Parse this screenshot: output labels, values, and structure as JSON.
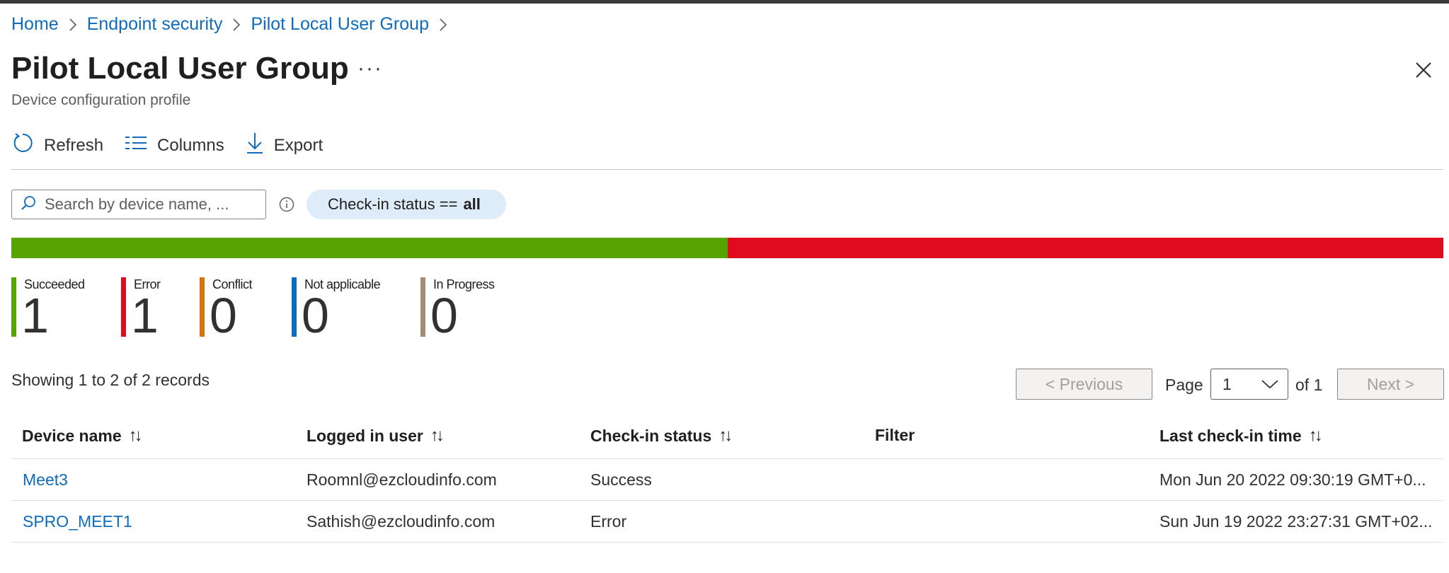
{
  "breadcrumb": [
    "Home",
    "Endpoint security",
    "Pilot Local User Group"
  ],
  "header": {
    "title": "Pilot Local User Group",
    "more": "···",
    "subtitle": "Device configuration profile"
  },
  "toolbar": {
    "refresh": "Refresh",
    "columns": "Columns",
    "export": "Export"
  },
  "search": {
    "placeholder": "Search by device name, ..."
  },
  "filter_pill": {
    "prefix": "Check-in status ==",
    "value": "all"
  },
  "status_bar": {
    "succeeded_fraction": 0.5,
    "error_fraction": 0.5,
    "ok_color": "#57a300",
    "error_color": "#e00b1c"
  },
  "legend": [
    {
      "label": "Succeeded",
      "value": "1",
      "color": "#57a300"
    },
    {
      "label": "Error",
      "value": "1",
      "color": "#e00b1c"
    },
    {
      "label": "Conflict",
      "value": "0",
      "color": "#d9730d"
    },
    {
      "label": "Not applicable",
      "value": "0",
      "color": "#0f6cbd"
    },
    {
      "label": "In Progress",
      "value": "0",
      "color": "#a68a74"
    }
  ],
  "records": "Showing 1 to 2 of 2 records",
  "pager": {
    "previous": "< Previous",
    "page_label": "Page",
    "page_value": "1",
    "of": "of 1",
    "next": "Next >"
  },
  "table": {
    "columns": [
      "Device name",
      "Logged in user",
      "Check-in status",
      "Filter",
      "Last check-in time"
    ],
    "sortable": [
      true,
      true,
      true,
      false,
      true
    ],
    "rows": [
      [
        "Meet3",
        "Roomnl@ezcloudinfo.com",
        "Success",
        "",
        "Mon Jun 20 2022 09:30:19 GMT+0..."
      ],
      [
        "SPRO_MEET1",
        "Sathish@ezcloudinfo.com",
        "Error",
        "",
        "Sun Jun 19 2022 23:27:31 GMT+02..."
      ]
    ]
  }
}
